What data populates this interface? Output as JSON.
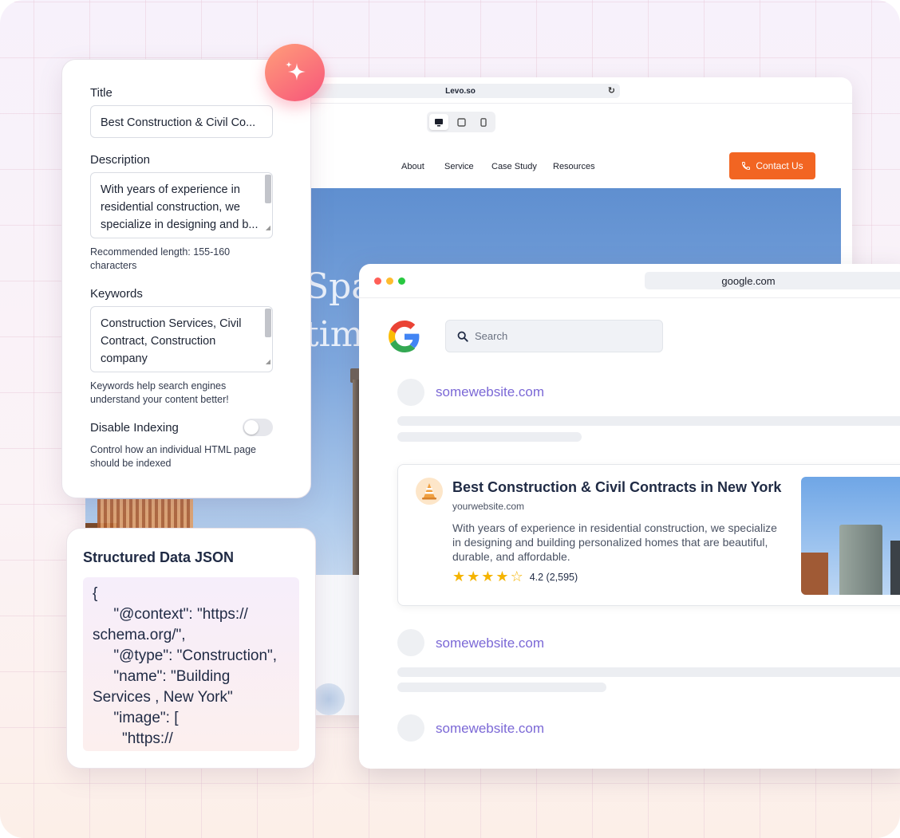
{
  "website": {
    "url": "Levo.so",
    "nav": [
      "About",
      "Service",
      "Case Study",
      "Resources"
    ],
    "contact_label": "Contact Us",
    "hero_line1": "Spac",
    "hero_line2": "tim"
  },
  "seo": {
    "title_label": "Title",
    "title_value": "Best Construction & Civil Co...",
    "description_label": "Description",
    "description_value": "With years of experience in residential construction, we specialize in designing and b...",
    "description_hint": "Recommended length: 155-160 characters",
    "keywords_label": "Keywords",
    "keywords_value": "Construction Services, Civil Contract, Construction company",
    "keywords_hint": "Keywords help search engines understand your content better!",
    "indexing_label": "Disable Indexing",
    "indexing_enabled": false,
    "indexing_hint": "Control how an individual HTML page should be indexed"
  },
  "structured_data": {
    "title": "Structured Data JSON",
    "code": "{\n     \"@context\": \"https://\nschema.org/\",\n     \"@type\": \"Construction\",\n     \"name\": \"Building\nServices , New York\"\n     \"image\": [\n       \"https://"
  },
  "google": {
    "url": "google.com",
    "search_placeholder": "Search",
    "results_top": "somewebsite.com",
    "featured": {
      "title": "Best Construction & Civil Contracts in New York",
      "url": "yourwebsite.com",
      "description": "With years of experience in residential construction, we specialize in designing and building personalized homes that are beautiful, durable, and affordable.",
      "rating": 4.2,
      "rating_text": "4.2 (2,595)",
      "stars_filled": 4
    },
    "results_mid": "somewebsite.com",
    "results_bottom": "somewebsite.com"
  },
  "colors": {
    "accent": "#f26522",
    "link": "#7b68d6",
    "star": "#f5b400"
  }
}
